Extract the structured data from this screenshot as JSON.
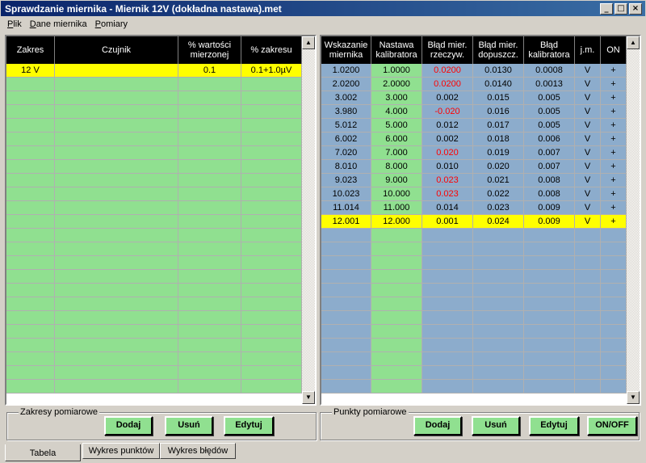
{
  "window": {
    "title": "Sprawdzanie miernika - Miernik 12V (dokładna nastawa).met",
    "minimize": "_",
    "maximize": "□",
    "close": "×"
  },
  "menu": [
    {
      "label_ul": "P",
      "label_rest": "lik"
    },
    {
      "label_ul": "D",
      "label_rest": "ane miernika"
    },
    {
      "label_ul": "P",
      "label_rest": "omiary"
    }
  ],
  "ranges_table": {
    "headers": [
      "Zakres",
      "Czujnik",
      "% wartości mierzonej",
      "% zakresu"
    ],
    "rows": [
      {
        "zakres": "12 V",
        "czujnik": "",
        "pct_value": "0.1",
        "pct_range": "0.1+1.0µV",
        "selected": true
      }
    ],
    "empty_rows": 23
  },
  "points_table": {
    "headers": [
      "Wskazanie miernika",
      "Nastawa kalibratora",
      "Błąd mier. rzeczyw.",
      "Błąd mier. dopuszcz.",
      "Błąd kalibratora",
      "j.m.",
      "ON"
    ],
    "rows": [
      {
        "reading": "1.0200",
        "setting": "1.0000",
        "err_actual": "0.0200",
        "err_actual_red": true,
        "err_allowed": "0.0130",
        "err_cal": "0.0008",
        "unit": "V",
        "on": "+"
      },
      {
        "reading": "2.0200",
        "setting": "2.0000",
        "err_actual": "0.0200",
        "err_actual_red": true,
        "err_allowed": "0.0140",
        "err_cal": "0.0013",
        "unit": "V",
        "on": "+"
      },
      {
        "reading": "3.002",
        "setting": "3.000",
        "err_actual": "0.002",
        "err_actual_red": false,
        "err_allowed": "0.015",
        "err_cal": "0.005",
        "unit": "V",
        "on": "+"
      },
      {
        "reading": "3.980",
        "setting": "4.000",
        "err_actual": "-0.020",
        "err_actual_red": true,
        "err_allowed": "0.016",
        "err_cal": "0.005",
        "unit": "V",
        "on": "+"
      },
      {
        "reading": "5.012",
        "setting": "5.000",
        "err_actual": "0.012",
        "err_actual_red": false,
        "err_allowed": "0.017",
        "err_cal": "0.005",
        "unit": "V",
        "on": "+"
      },
      {
        "reading": "6.002",
        "setting": "6.000",
        "err_actual": "0.002",
        "err_actual_red": false,
        "err_allowed": "0.018",
        "err_cal": "0.006",
        "unit": "V",
        "on": "+"
      },
      {
        "reading": "7.020",
        "setting": "7.000",
        "err_actual": "0.020",
        "err_actual_red": true,
        "err_allowed": "0.019",
        "err_cal": "0.007",
        "unit": "V",
        "on": "+"
      },
      {
        "reading": "8.010",
        "setting": "8.000",
        "err_actual": "0.010",
        "err_actual_red": false,
        "err_allowed": "0.020",
        "err_cal": "0.007",
        "unit": "V",
        "on": "+"
      },
      {
        "reading": "9.023",
        "setting": "9.000",
        "err_actual": "0.023",
        "err_actual_red": true,
        "err_allowed": "0.021",
        "err_cal": "0.008",
        "unit": "V",
        "on": "+"
      },
      {
        "reading": "10.023",
        "setting": "10.000",
        "err_actual": "0.023",
        "err_actual_red": true,
        "err_allowed": "0.022",
        "err_cal": "0.008",
        "unit": "V",
        "on": "+"
      },
      {
        "reading": "11.014",
        "setting": "11.000",
        "err_actual": "0.014",
        "err_actual_red": false,
        "err_allowed": "0.023",
        "err_cal": "0.009",
        "unit": "V",
        "on": "+"
      },
      {
        "reading": "12.001",
        "setting": "12.000",
        "err_actual": "0.001",
        "err_actual_red": false,
        "err_allowed": "0.024",
        "err_cal": "0.009",
        "unit": "V",
        "on": "+",
        "selected": true
      }
    ],
    "empty_rows": 12
  },
  "ranges_group": {
    "title": "Zakresy pomiarowe",
    "add": "Dodaj",
    "delete": "Usuń",
    "edit": "Edytuj"
  },
  "points_group": {
    "title": "Punkty pomiarowe",
    "add": "Dodaj",
    "delete": "Usuń",
    "edit": "Edytuj",
    "onoff": "ON/OFF"
  },
  "tabs": [
    "Tabela",
    "Wykres punktów",
    "Wykres błędów"
  ],
  "colors": {
    "green": "#90e090",
    "blue": "#8caccc",
    "selected": "#ffff00",
    "error_red": "#ff0000"
  }
}
